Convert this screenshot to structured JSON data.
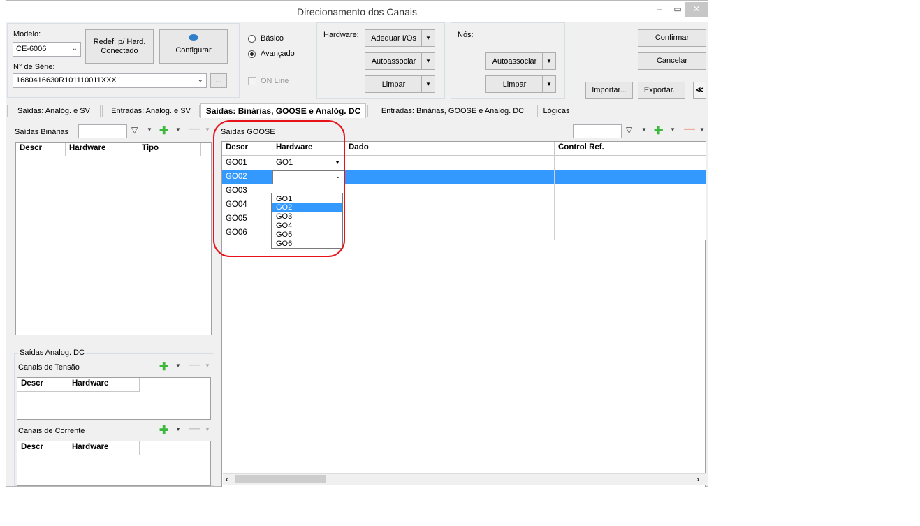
{
  "window": {
    "title": "Direcionamento dos Canais",
    "minimize": "–",
    "maximize": "▭",
    "close": "✕"
  },
  "header": {
    "modelo_label": "Modelo:",
    "modelo_value": "CE-6006",
    "serie_label": "N° de Série:",
    "serie_value": "1680416630R101110011XXX",
    "ellipsis": "...",
    "redef_label": "Redef. p/ Hard. Conectado",
    "configurar_label": "Configurar",
    "basico_label": "Básico",
    "avancado_label": "Avançado",
    "online_label": "ON Line",
    "hardware_label": "Hardware:",
    "adequar_label": "Adequar I/Os",
    "hw_autoassociar_label": "Autoassociar",
    "hw_limpar_label": "Limpar",
    "nos_label": "Nós:",
    "nos_autoassociar_label": "Autoassociar",
    "nos_limpar_label": "Limpar",
    "confirmar_label": "Confirmar",
    "cancelar_label": "Cancelar",
    "importar_label": "Importar...",
    "exportar_label": "Exportar...",
    "collapse_icon": "double-chevron-up-icon"
  },
  "tabs": [
    {
      "label": "Saídas: Analóg. e SV"
    },
    {
      "label": "Entradas: Analóg. e SV"
    },
    {
      "label": "Saídas: Binárias, GOOSE e Analóg. DC",
      "active": true
    },
    {
      "label": "Entradas: Binárias, GOOSE e Analóg. DC"
    },
    {
      "label": "Lógicas"
    }
  ],
  "binarias": {
    "title": "Saídas Binárias",
    "columns": [
      "Descr",
      "Hardware",
      "Tipo"
    ]
  },
  "analog_dc": {
    "title": "Saídas Analog. DC",
    "tensao_title": "Canais de Tensão",
    "corrente_title": "Canais de Corrente",
    "columns": [
      "Descr",
      "Hardware"
    ]
  },
  "goose": {
    "title": "Saídas GOOSE",
    "columns": [
      "Descr",
      "Hardware",
      "Dado",
      "Control Ref."
    ],
    "rows": [
      {
        "descr": "GO01",
        "hardware": "GO1"
      },
      {
        "descr": "GO02",
        "hardware": ""
      },
      {
        "descr": "GO03",
        "hardware": ""
      },
      {
        "descr": "GO04",
        "hardware": ""
      },
      {
        "descr": "GO05",
        "hardware": ""
      },
      {
        "descr": "GO06",
        "hardware": ""
      }
    ],
    "dropdown_options": [
      "GO1",
      "GO2",
      "GO3",
      "GO4",
      "GO5",
      "GO6"
    ],
    "dropdown_selected": "GO2"
  },
  "colors": {
    "selection": "#3399ff",
    "highlight_circle": "#e8121b",
    "plus": "#3db83d",
    "minus_active": "#f06a4a"
  }
}
